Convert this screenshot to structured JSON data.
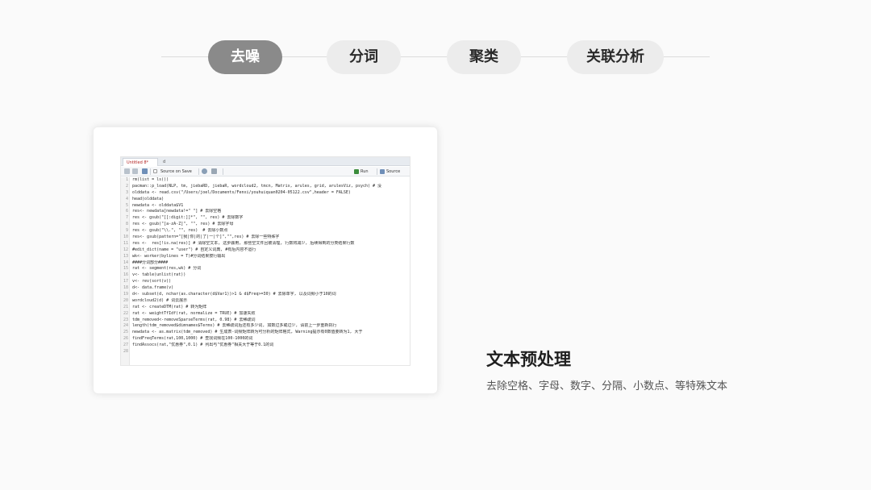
{
  "steps": [
    {
      "label": "去噪",
      "active": true
    },
    {
      "label": "分词",
      "active": false
    },
    {
      "label": "聚类",
      "active": false
    },
    {
      "label": "关联分析",
      "active": false
    }
  ],
  "editor": {
    "tabs": [
      "Untitled 8*",
      "d"
    ],
    "toolbar": {
      "source_on_save": "Source on Save",
      "run": "Run",
      "source": "Source"
    },
    "line_numbers": [
      "1",
      "2",
      "3",
      "4",
      "5",
      "6",
      "7",
      "8",
      "9",
      "10",
      "11",
      "12",
      "13",
      "14",
      "15",
      "16",
      "17",
      "18",
      "19",
      "20",
      "21",
      "22",
      "23",
      "24",
      "25",
      "26",
      "27",
      "28"
    ],
    "code_lines": [
      "rm(list = ls())",
      "pacman::p_load(NLP, tm, jiebaRD, jiebaR, wordcloud2, tmcn, Matrix, arules, grid, arulesViz, psych) # 没",
      "olddata <- read.csv(\"/Users/joel/Documents/Fenxi/youhuiquan0204-05122.csv\",header = FALSE)",
      "head(olddata)",
      "newdata <- olddata$V1",
      "res<- newdata[newdata!=\" \"] # 去除空格",
      "res <- gsub(\"[[:digit:]]*\", \"\", res) # 去除数字",
      "res <- gsub(\"[a-zA-Z]\", \"\", res) # 去除字母",
      "res <- gsub(\"\\\\.\", \"\", res)  # 去除小数点",
      "res<- gsub(pattern=\"[我|你|的|了|一|个]\",\"\",res) # 去除一些特殊字",
      "res <-  res[!is.na(res)] # 清除空文本, 这步骤用, 那些空文件且被清理, 行数将减少, 后续得到的分类结果行数",
      "#edit_dict(name = \"user\") # 自定义词典, #有后内容不运行",
      "wk<- worker(bylines = T)#分词结果按行输出",
      "####分词部分####",
      "rat <- segment(res,wk) # 分词",
      "v<- table(unlist(rat))",
      "v<- rev(sort(v))",
      "d<- data.frame(v)",
      "d<- subset(d, nchar(as.character(d$Var1))>1 & d$Freq>=30) # 去除单字, 以及词频小于10的词",
      "wordcloud2(d) # 词云展示",
      "rat <- createDTM(rat) # 转为矩阵",
      "rat <- weightTfIdf(rat, normalize = TRUE) # 加速失败",
      "tdm_removed<-removeSparseTerms(rat, 0.98) # 去稀疏词",
      "length(tdm_removed$dimnames$Terms) # 去稀疏词后还有多少词, 如数过多或过少, 请前上一步重新执行",
      "newdata <- as.matrix(tdm_removed) # 生成表-词频矩阵转为可分析的矩阵格式, Warning提示有0数值要转为1, 大于",
      "findFreqTerms(rat,100,1000) # 查找词频在100-1000的词",
      "findAssocs(rat,\"优惠券\",0.1) # 列出与\"优惠券\"相关大于等于0.1的词",
      ""
    ]
  },
  "section": {
    "title": "文本预处理",
    "description": "去除空格、字母、数字、分隔、小数点、等特殊文本"
  },
  "colors": {
    "active_step": "#8a8a8a",
    "inactive_step": "#ececec",
    "tab_active_text": "#b22222"
  }
}
